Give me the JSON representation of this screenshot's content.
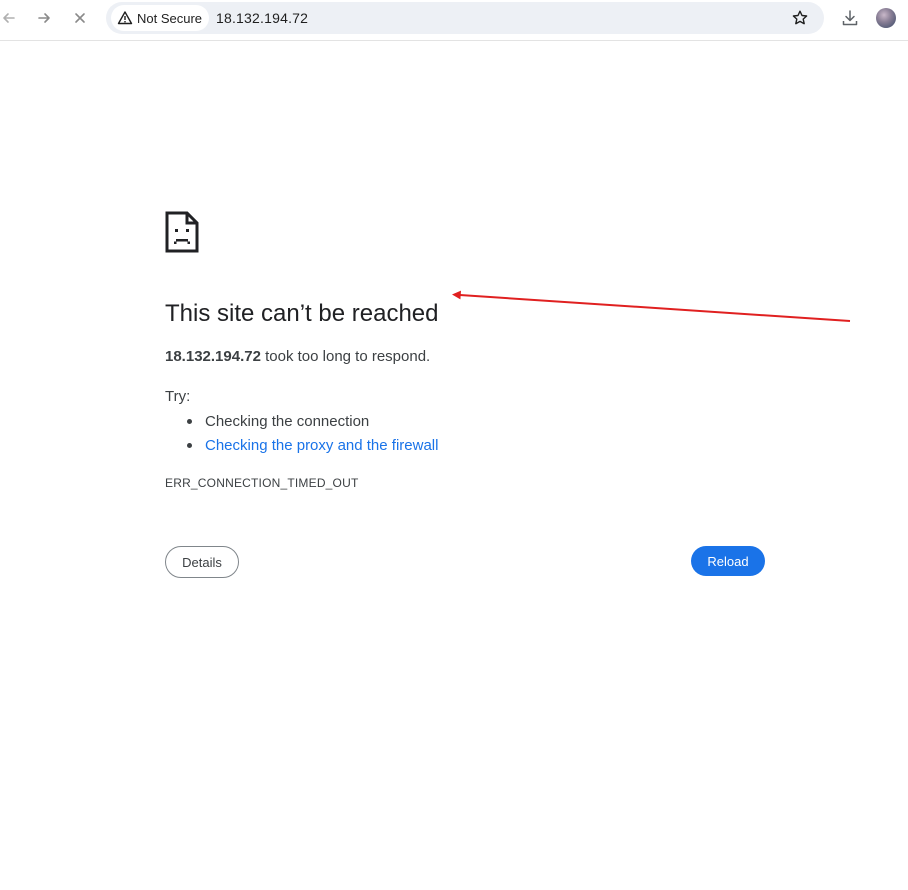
{
  "browser": {
    "security_label": "Not Secure",
    "url": "18.132.194.72",
    "icons": {
      "back": "arrow-left-icon",
      "forward": "arrow-right-icon",
      "stop": "close-icon",
      "warning": "warning-triangle-icon",
      "bookmark": "star-icon",
      "downloads": "download-icon",
      "profile": "avatar"
    }
  },
  "error_page": {
    "icon": "sad-document-icon",
    "title": "This site can’t be reached",
    "summary_host": "18.132.194.72",
    "summary_text": " took too long to respond.",
    "try_label": "Try:",
    "suggestions": [
      "Checking the connection",
      "Checking the proxy and the firewall"
    ],
    "error_code": "ERR_CONNECTION_TIMED_OUT",
    "details_label": "Details",
    "reload_label": "Reload"
  },
  "colors": {
    "link": "#1a73e8",
    "primary_button": "#1a73e8",
    "annotation_arrow": "#e02020"
  }
}
